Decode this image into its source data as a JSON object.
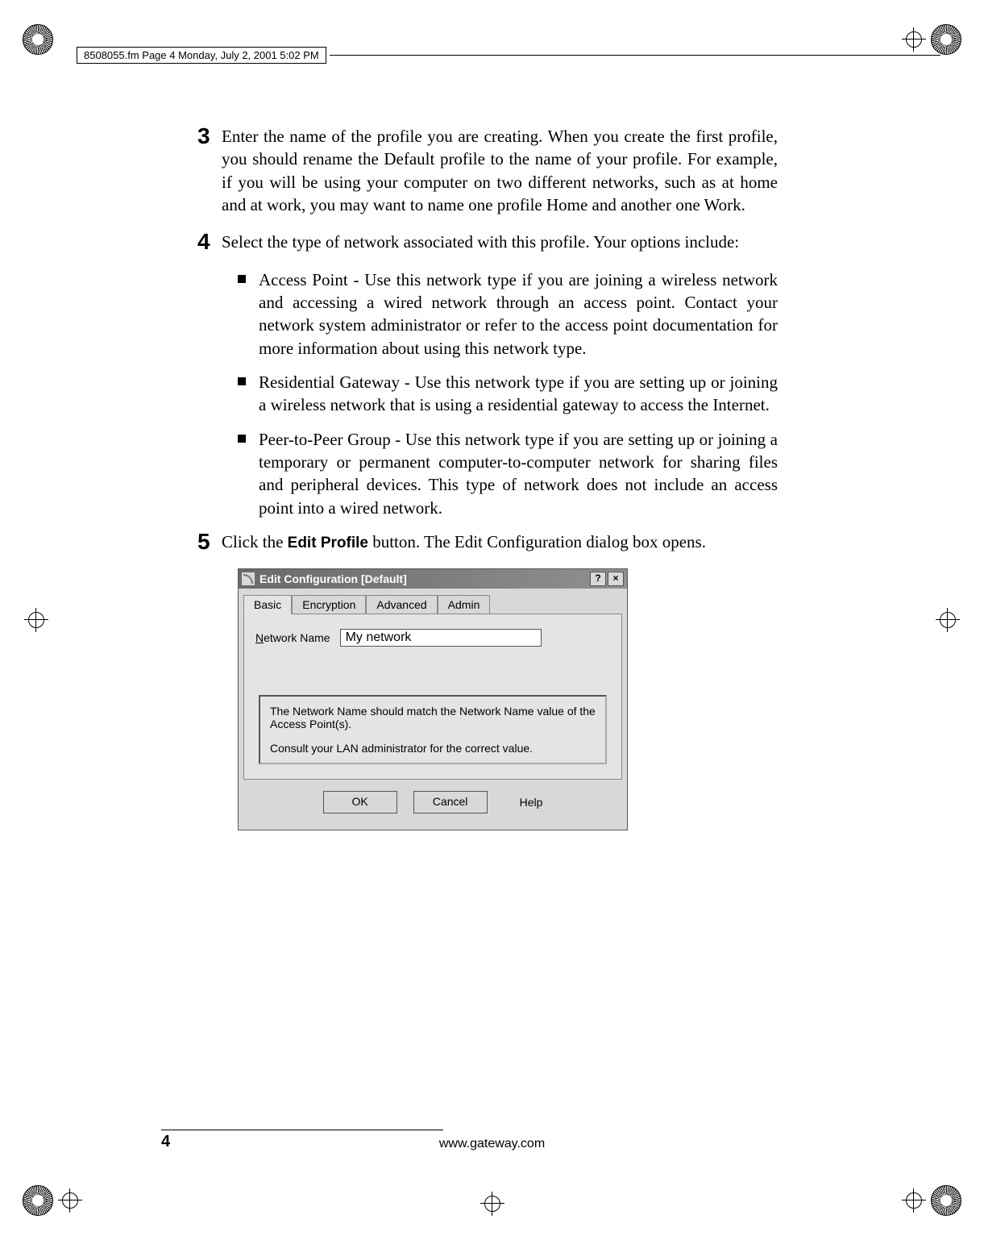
{
  "print_header_text": "8508055.fm  Page 4  Monday, July 2, 2001  5:02 PM",
  "steps": {
    "s3": {
      "num": "3",
      "text": "Enter the name of the profile you are creating. When you create the first profile, you should rename the Default profile to the name of your profile. For example, if you will be using your computer on two different networks, such as at home and at work, you may want to name one profile Home and another one Work."
    },
    "s4": {
      "num": "4",
      "text": "Select the type of network associated with this profile. Your options include:"
    },
    "s5": {
      "num": "5",
      "text_pre": "Click the ",
      "bold": "Edit Profile",
      "text_post": " button. The Edit Configuration dialog box opens."
    }
  },
  "bullets": {
    "b1": "Access Point - Use this network type if you are joining a wireless network and accessing a wired network through an access point. Contact your network system administrator or refer to the access point documentation for more information about using this network type.",
    "b2": "Residential Gateway - Use this network type if you are setting up or joining a wireless network that is using a residential gateway to access the Internet.",
    "b3": "Peer-to-Peer Group - Use this network type if you are setting up or joining a temporary or permanent computer-to-computer network for sharing files and peripheral devices. This type of network does not include an access point into a wired network."
  },
  "dialog": {
    "title": "Edit Configuration [Default]",
    "tabs": {
      "t1": "Basic",
      "t2": "Encryption",
      "t3": "Advanced",
      "t4": "Admin"
    },
    "field_label_u": "N",
    "field_label_rest": "etwork Name",
    "field_value": "My network",
    "info_p1": "The Network Name should match the Network Name value of the Access Point(s).",
    "info_p2": "Consult your LAN administrator for the correct value.",
    "btn_ok": "OK",
    "btn_cancel": "Cancel",
    "btn_help": "Help",
    "help_char": "?",
    "close_char": "×"
  },
  "footer": {
    "page": "4",
    "url": "www.gateway.com"
  }
}
